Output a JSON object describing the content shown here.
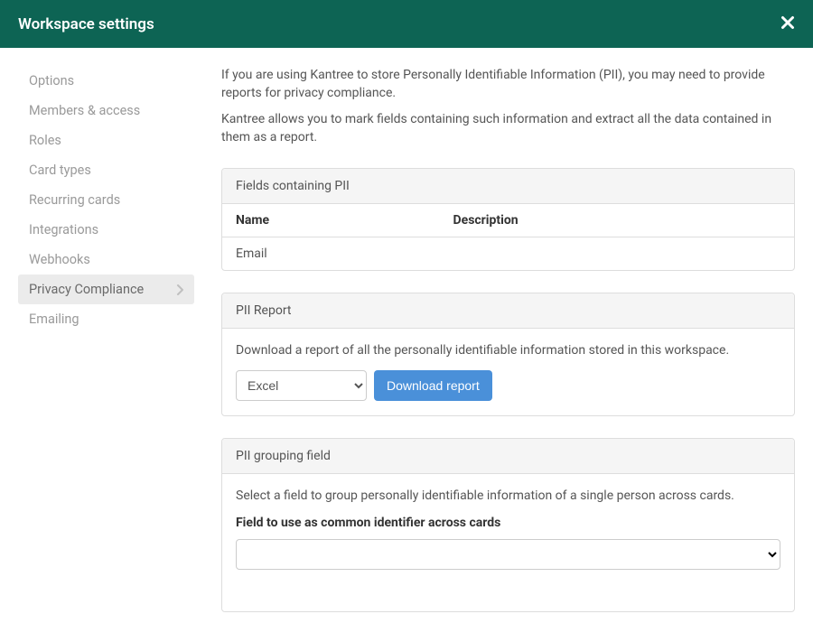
{
  "header": {
    "title": "Workspace settings"
  },
  "sidebar": {
    "items": [
      {
        "label": "Options",
        "active": false
      },
      {
        "label": "Members & access",
        "active": false
      },
      {
        "label": "Roles",
        "active": false
      },
      {
        "label": "Card types",
        "active": false
      },
      {
        "label": "Recurring cards",
        "active": false
      },
      {
        "label": "Integrations",
        "active": false
      },
      {
        "label": "Webhooks",
        "active": false
      },
      {
        "label": "Privacy Compliance",
        "active": true
      },
      {
        "label": "Emailing",
        "active": false
      }
    ]
  },
  "intro": {
    "p1": "If you are using Kantree to store Personally Identifiable Information (PII), you may need to provide reports for privacy compliance.",
    "p2": "Kantree allows you to mark fields containing such information and extract all the data contained in them as a report."
  },
  "fieldsPanel": {
    "title": "Fields containing PII",
    "columns": {
      "name": "Name",
      "description": "Description"
    },
    "rows": [
      {
        "name": "Email",
        "description": ""
      }
    ]
  },
  "reportPanel": {
    "title": "PII Report",
    "text": "Download a report of all the personally identifiable information stored in this workspace.",
    "formatOptions": [
      "Excel"
    ],
    "selectedFormat": "Excel",
    "buttonLabel": "Download report"
  },
  "groupingPanel": {
    "title": "PII grouping field",
    "text": "Select a field to group personally identifiable information of a single person across cards.",
    "label": "Field to use as common identifier across cards",
    "selected": ""
  }
}
